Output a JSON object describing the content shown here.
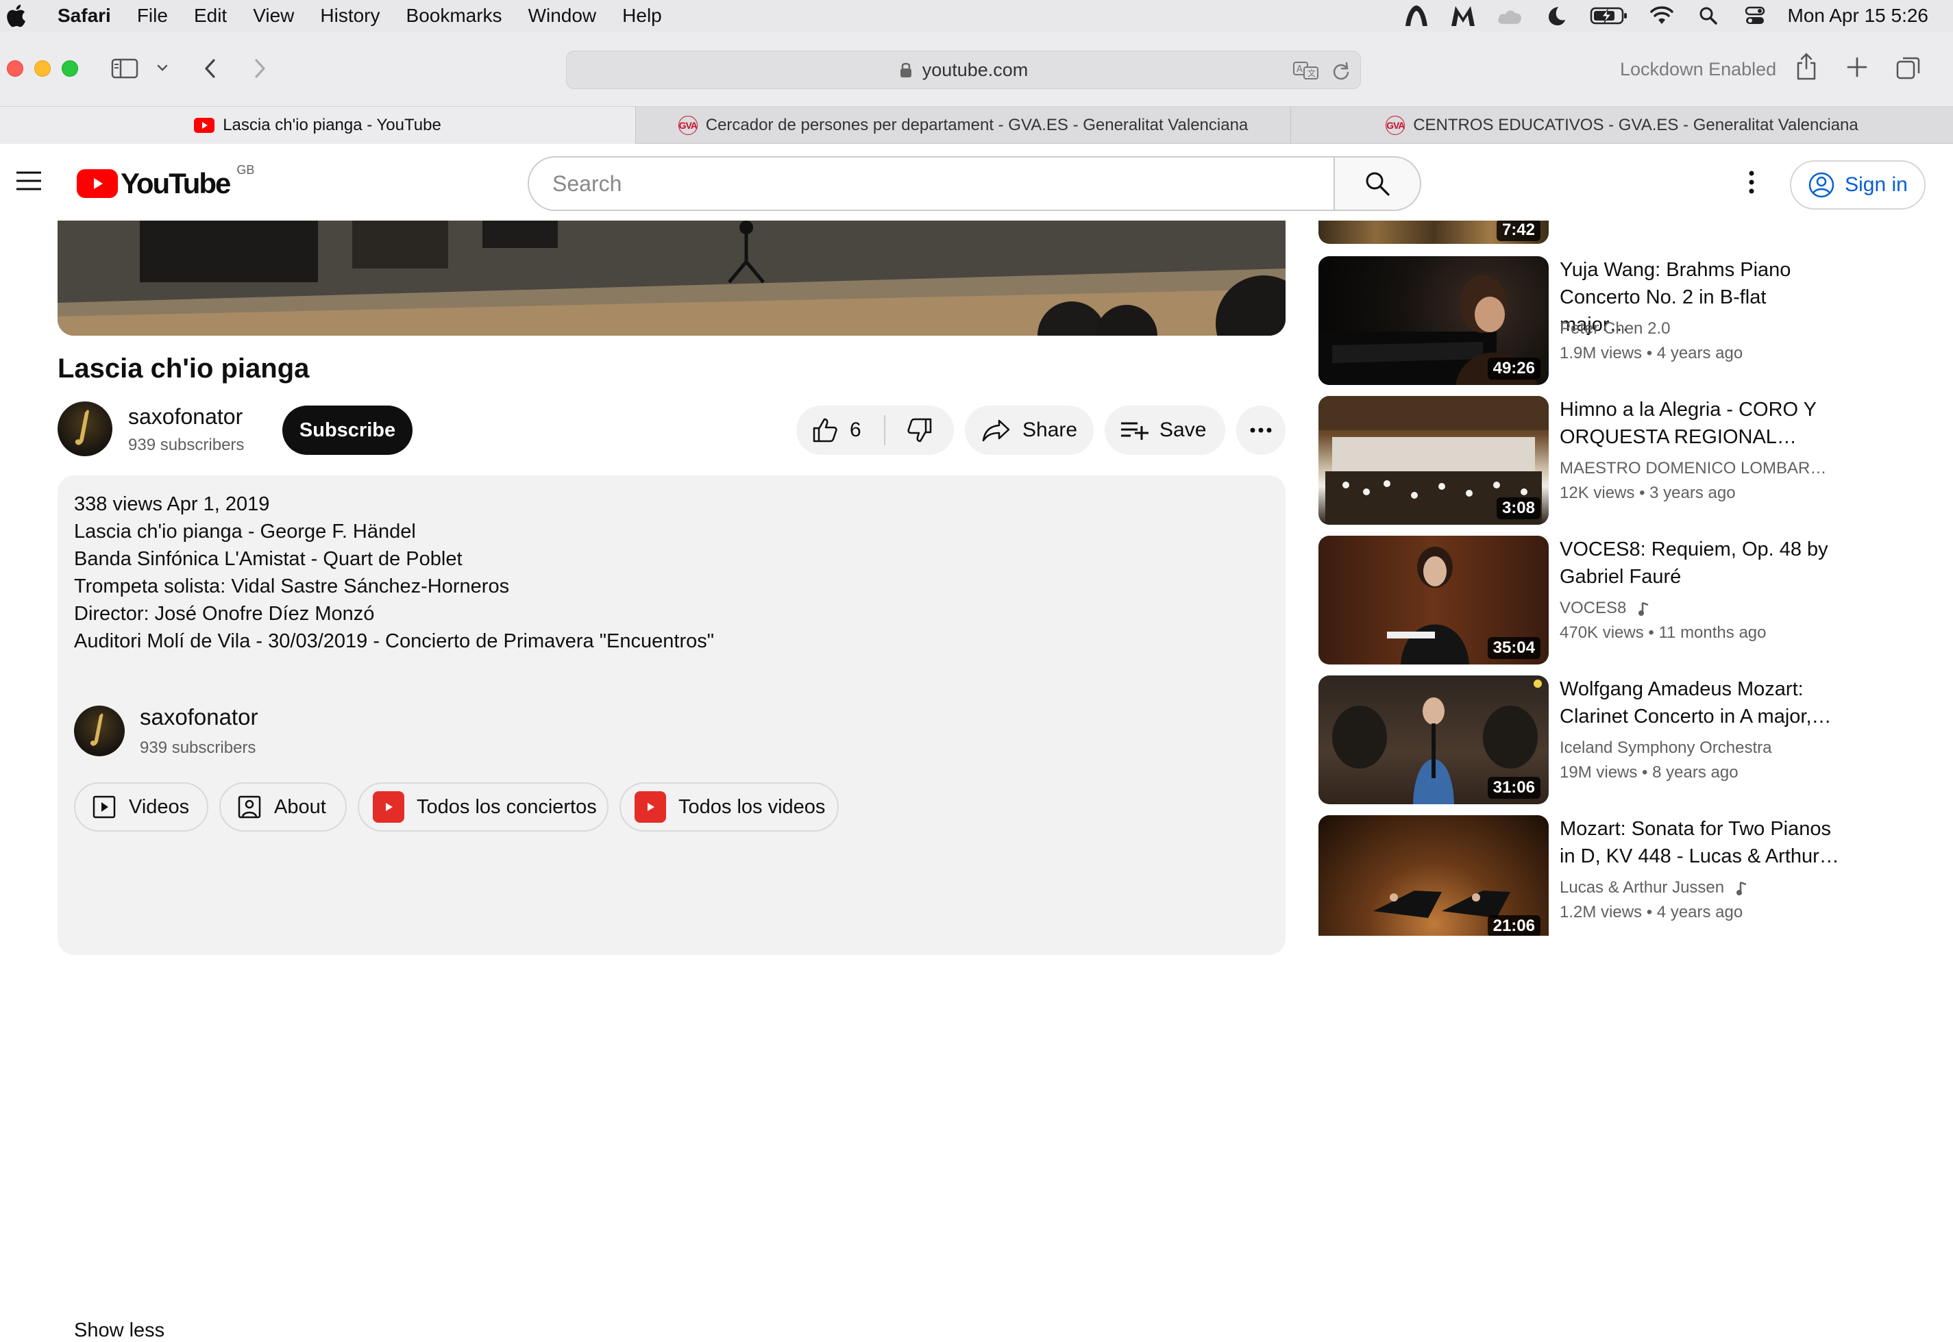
{
  "menubar": {
    "items": [
      "Safari",
      "File",
      "Edit",
      "View",
      "History",
      "Bookmarks",
      "Window",
      "Help"
    ],
    "clock": "Mon Apr 15  5:26"
  },
  "toolbar": {
    "address": "youtube.com",
    "lockdown": "Lockdown Enabled"
  },
  "tabs": [
    {
      "title": "Lascia ch'io pianga - YouTube",
      "favicon": "youtube-icon"
    },
    {
      "title": "Cercador de persones per departament - GVA.ES - Generalitat Valenciana",
      "favicon": "gva-icon"
    },
    {
      "title": "CENTROS EDUCATIVOS - GVA.ES - Generalitat Valenciana",
      "favicon": "gva-icon"
    }
  ],
  "favicon_text": "GVA",
  "youtube": {
    "logo": "YouTube",
    "region": "GB",
    "search_placeholder": "Search",
    "sign_in": "Sign in"
  },
  "video": {
    "title": "Lascia ch'io pianga",
    "channel": "saxofonator",
    "subscribers": "939 subscribers",
    "subscribe": "Subscribe",
    "likes": "6",
    "share": "Share",
    "save": "Save"
  },
  "description": {
    "lines": [
      "338 views  Apr 1, 2019",
      "Lascia ch'io pianga - George F. Händel",
      "Banda Sinfónica L'Amistat - Quart de Poblet",
      "Trompeta solista: Vidal Sastre Sánchez-Horneros",
      "Director: José Onofre Díez Monzó",
      "Auditori Molí de Vila - 30/03/2019 - Concierto de Primavera \"Encuentros\""
    ],
    "channel": "saxofonator",
    "subscribers": "939 subscribers",
    "chips": [
      "Videos",
      "About",
      "Todos los conciertos",
      "Todos los videos"
    ],
    "show_less": "Show less"
  },
  "sidebar": {
    "top_partial_duration": "7:42",
    "items": [
      {
        "title": "Yuja Wang: Brahms Piano Concerto No. 2 in B-flat major…",
        "channel": "Peter Chen 2.0",
        "views": "1.9M views",
        "age": "4 years ago",
        "duration": "49:26",
        "music": false
      },
      {
        "title": "Himno a la Alegria - CORO Y ORQUESTA REGIONAL…",
        "channel": "MAESTRO DOMENICO LOMBAR…",
        "views": "12K views",
        "age": "3 years ago",
        "duration": "3:08",
        "music": false
      },
      {
        "title": "VOCES8: Requiem, Op. 48 by Gabriel Fauré",
        "channel": "VOCES8",
        "views": "470K views",
        "age": "11 months ago",
        "duration": "35:04",
        "music": true
      },
      {
        "title": "Wolfgang Amadeus Mozart: Clarinet Concerto in A major,…",
        "channel": "Iceland Symphony Orchestra",
        "views": "19M views",
        "age": "8 years ago",
        "duration": "31:06",
        "music": false
      },
      {
        "title": "Mozart: Sonata for Two Pianos in D, KV 448 - Lucas & Arthur…",
        "channel": "Lucas & Arthur Jussen",
        "views": "1.2M views",
        "age": "4 years ago",
        "duration": "21:06",
        "music": true
      }
    ]
  },
  "colors": {
    "youtube_red": "#ff0000",
    "link_blue": "#065fd4"
  }
}
